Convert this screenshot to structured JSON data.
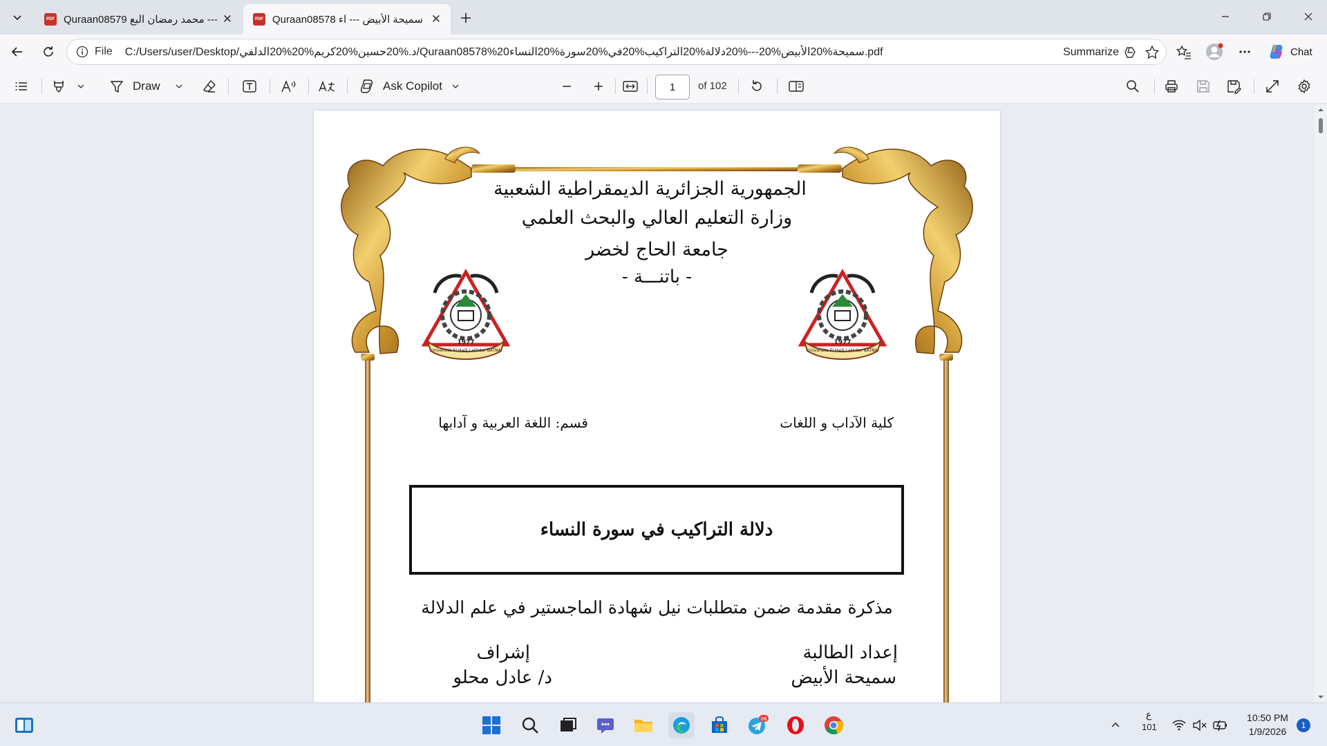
{
  "tabs": [
    {
      "title": "Quraan08579 محمد رمضان البع ---",
      "active": false
    },
    {
      "title": "Quraan08578 سميحة الأبيض --- اء",
      "active": true
    }
  ],
  "address": {
    "scheme": "File",
    "url": "C:/Users/user/Desktop/د.%20حسين%20كريم%20%20الدلفي/Quraan08578%20سميحة%20الأبيض%20---%20دلالة%20التراكيب%20في%20سورة%20النساء.pdf",
    "summarize_label": "Summarize",
    "chat_label": "Chat"
  },
  "pdf_toolbar": {
    "draw_label": "Draw",
    "copilot_label": "Ask Copilot",
    "page_number": "1",
    "page_count": "of 102"
  },
  "document": {
    "line1": "الجمهورية الجزائرية الديمقراطية الشعبية",
    "line2": "وزارة التعليم العالي والبحث العلمي",
    "university": "جامعة الحاج لخضر",
    "city": "-  باتنـــة -",
    "faculty": "كلية الآداب و اللغات",
    "department": "قسم: اللغة العربية و آدابها",
    "title": "دلالة التراكيب في سورة النساء",
    "subtitle": "مذكرة مقدمة ضمن متطلبات نيل شهادة الماجستير  في علم الدلالة",
    "prepared_label": "إعداد الطالبة",
    "student": "سميحة الأبيض",
    "supervision_label": "إشراف",
    "supervisor": "د/ عادل محلو",
    "logo_text": "جامعة الحاج لخضر باتنة",
    "logo_year": "1977",
    "logo_latin": "Université El Hadj Lakhdar BATNA"
  },
  "taskbar": {
    "lang_top": "ع",
    "lang_bottom": "101",
    "time": "10:50 PM",
    "date": "1/9/2026",
    "notif_count": "1",
    "telegram_badge": "06"
  }
}
